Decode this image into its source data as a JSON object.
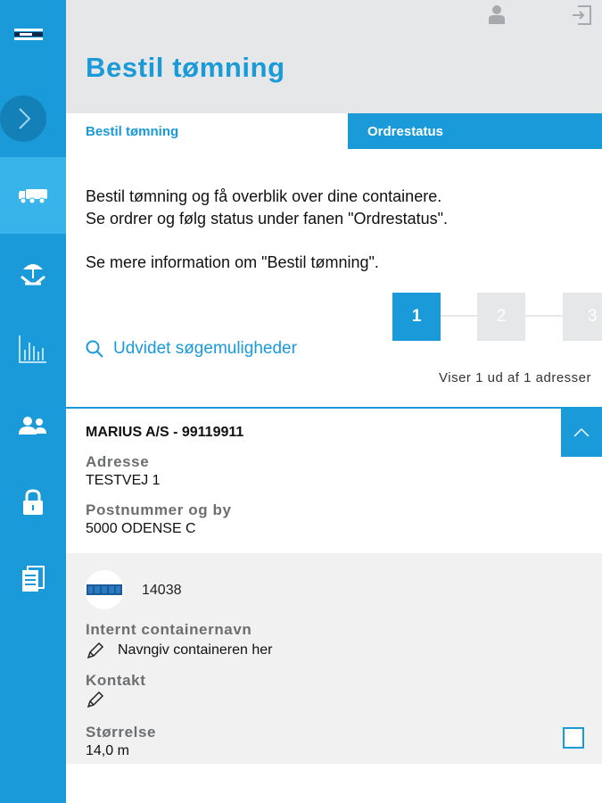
{
  "header": {
    "title": "Bestil tømning"
  },
  "tabs": [
    {
      "label": "Bestil tømning"
    },
    {
      "label": "Ordrestatus"
    }
  ],
  "intro": {
    "line1": "Bestil tømning og få overblik over dine containere.",
    "line2": "Se ordrer og følg status under fanen \"Ordrestatus\".",
    "more": "Se mere information om \"Bestil tømning\"."
  },
  "pager": {
    "pages": [
      "1",
      "2",
      "3"
    ],
    "current": "1"
  },
  "search": {
    "label": "Udvidet søgemuligheder"
  },
  "results": {
    "count_text": "Viser 1 ud af 1 adresser"
  },
  "customer": {
    "name": "MARIUS A/S - 99119911",
    "address_label": "Adresse",
    "address": "TESTVEJ 1",
    "postal_label": "Postnummer og by",
    "postal": "5000 ODENSE C"
  },
  "container": {
    "id": "14038",
    "internal_name_label": "Internt containernavn",
    "internal_name_placeholder": "Navngiv containeren her",
    "contact_label": "Kontakt",
    "size_label": "Størrelse",
    "size": "14,0 m"
  },
  "sidebar": {
    "items": [
      "logo",
      "expand",
      "truck",
      "cleaning",
      "statistics",
      "users",
      "lock",
      "documents"
    ],
    "active": "truck"
  },
  "colors": {
    "accent": "#1a9ad9",
    "sidebar_active": "#38b4ea",
    "header_bg": "#e6e7e8",
    "section_bg": "#f1f1f2",
    "label_gray": "#6d6e70"
  }
}
